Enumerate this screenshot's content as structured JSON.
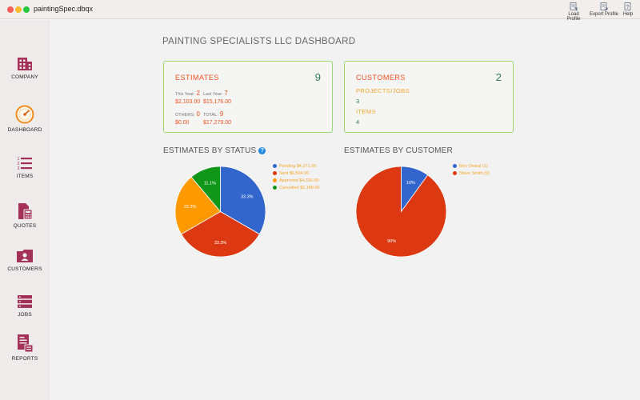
{
  "window": {
    "title": "paintingSpec.dbqx"
  },
  "toolbar": {
    "load_label": "Load Profile",
    "export_label": "Export Profile",
    "help_label": "Help"
  },
  "sidebar": {
    "items": [
      {
        "label": "COMPANY",
        "icon": "building-icon"
      },
      {
        "label": "DASHBOARD",
        "icon": "gauge-icon"
      },
      {
        "label": "ITEMS",
        "icon": "list-icon"
      },
      {
        "label": "QUOTES",
        "icon": "calculator-icon"
      },
      {
        "label": "CUSTOMERS",
        "icon": "contact-icon"
      },
      {
        "label": "JOBS",
        "icon": "stack-icon"
      },
      {
        "label": "REPORTS",
        "icon": "report-icon"
      }
    ],
    "icon_color": "#a3315a"
  },
  "dashboard": {
    "title": "PAINTING SPECIALISTS LLC DASHBOARD",
    "estimates": {
      "title": "ESTIMATES",
      "total": "9",
      "this_year_label": "This Year:",
      "this_year_count": "2",
      "this_year_amount": "$2,103.00",
      "last_year_label": "Last Year:",
      "last_year_count": "7",
      "last_year_amount": "$15,176.00",
      "others_label": "OTHERS:",
      "others_count": "0",
      "others_amount": "$0.00",
      "total_label": "TOTAL:",
      "total_count": "9",
      "total_amount": "$17,279.00"
    },
    "customers": {
      "title": "CUSTOMERS",
      "total": "2",
      "projects_label": "PROJECTS/JOBS",
      "projects_value": "3",
      "items_label": "ITEMS",
      "items_value": "4"
    },
    "status_section_title": "ESTIMATES BY STATUS",
    "customer_section_title": "ESTIMATES BY CUSTOMER"
  },
  "colors": {
    "accent": "#f4511e",
    "card_border": "#9ed873",
    "total_green": "#2e7d5b",
    "legend_text": "#f4a62a"
  },
  "chart_data": [
    {
      "type": "pie",
      "title": "ESTIMATES BY STATUS",
      "legend_position": "right",
      "slices": [
        {
          "label": "Pending $4,271.00",
          "value": 33.3,
          "display": "33.3%",
          "color": "#3366cc"
        },
        {
          "label": "Sent $6,504.00",
          "value": 33.3,
          "display": "33.3%",
          "color": "#dc3912"
        },
        {
          "label": "Approved $4,336.00",
          "value": 22.2,
          "display": "22.2%",
          "color": "#ff9900"
        },
        {
          "label": "Cancelled $2,168.00",
          "value": 11.1,
          "display": "11.1%",
          "color": "#109618"
        }
      ]
    },
    {
      "type": "pie",
      "title": "ESTIMATES BY CUSTOMER",
      "legend_position": "right",
      "slices": [
        {
          "label": "Ben Omeal (1)",
          "value": 10,
          "display": "10%",
          "color": "#3366cc"
        },
        {
          "label": "Steve Smith (9)",
          "value": 90,
          "display": "90%",
          "color": "#dc3912"
        }
      ]
    }
  ]
}
